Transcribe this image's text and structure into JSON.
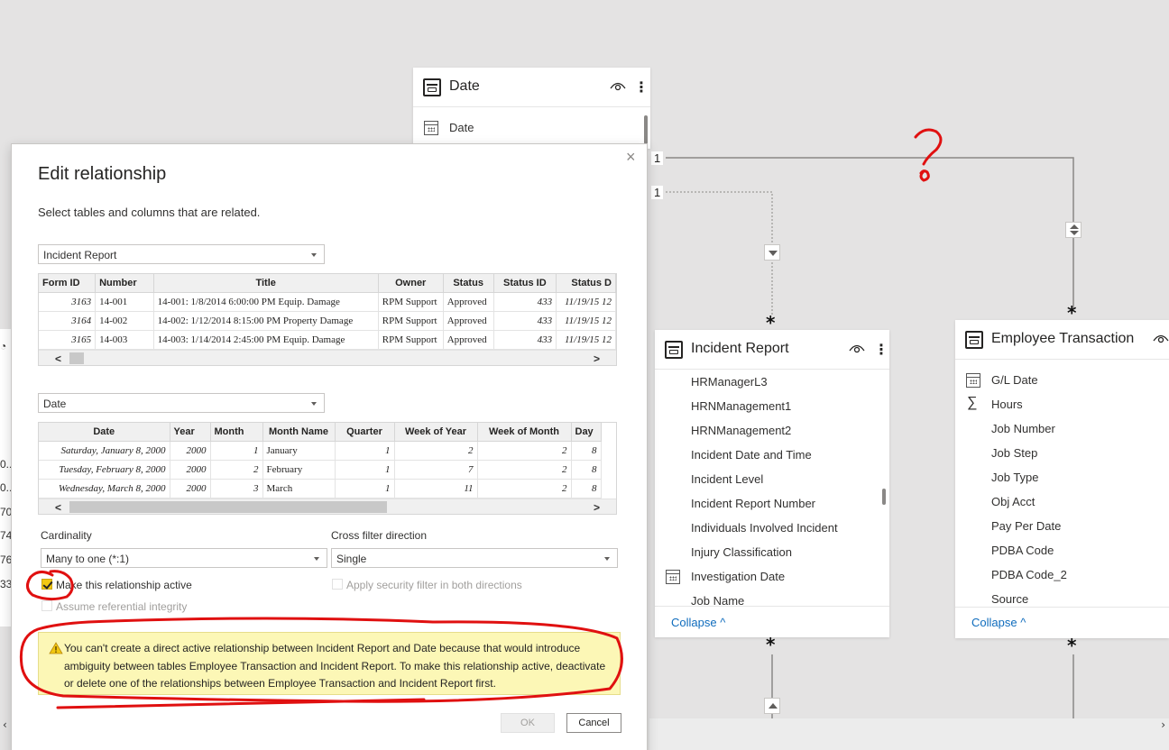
{
  "colors": {
    "canvas": "#e4e3e3",
    "accent_link": "#0f6cbd",
    "warning_bg": "#fcf7b6",
    "checkbox_checked": "#f2c811",
    "annotation_red": "#e01010"
  },
  "date_table": {
    "title": "Date",
    "fields": [
      {
        "name": "Date",
        "icon": "calendar-icon"
      }
    ]
  },
  "relationships": {
    "one_label_1": "1",
    "one_label_2": "1",
    "many_label": "*"
  },
  "incident_table": {
    "title": "Incident Report",
    "fields": [
      {
        "name": "HRManagerL3",
        "icon": ""
      },
      {
        "name": "HRNManagement1",
        "icon": ""
      },
      {
        "name": "HRNManagement2",
        "icon": ""
      },
      {
        "name": "Incident Date and Time",
        "icon": ""
      },
      {
        "name": "Incident Level",
        "icon": ""
      },
      {
        "name": "Incident Report Number",
        "icon": ""
      },
      {
        "name": "Individuals Involved Incident",
        "icon": ""
      },
      {
        "name": "Injury Classification",
        "icon": ""
      },
      {
        "name": "Investigation Date",
        "icon": "calendar-icon"
      },
      {
        "name": "Job Name",
        "icon": ""
      }
    ],
    "collapse": "Collapse"
  },
  "employee_table": {
    "title": "Employee Transaction",
    "fields": [
      {
        "name": "G/L Date",
        "icon": "calendar-icon"
      },
      {
        "name": "Hours",
        "icon": "sigma-icon"
      },
      {
        "name": "Job Number",
        "icon": ""
      },
      {
        "name": "Job Step",
        "icon": ""
      },
      {
        "name": "Job Type",
        "icon": ""
      },
      {
        "name": "Obj Acct",
        "icon": ""
      },
      {
        "name": "Pay Per Date",
        "icon": ""
      },
      {
        "name": "PDBA Code",
        "icon": ""
      },
      {
        "name": "PDBA Code_2",
        "icon": ""
      },
      {
        "name": "Source",
        "icon": ""
      }
    ],
    "collapse": "Collapse"
  },
  "left_partial": [
    "0...",
    "0...",
    "70",
    "74",
    "76",
    "33"
  ],
  "dialog": {
    "title": "Edit relationship",
    "subtitle": "Select tables and columns that are related.",
    "table1": {
      "selected": "Incident Report",
      "columns": [
        "Form ID",
        "Number",
        "Title",
        "Owner",
        "Status",
        "Status ID",
        "Status D"
      ],
      "rows": [
        [
          "3163",
          "14-001",
          "14-001: 1/8/2014 6:00:00 PM Equip. Damage",
          "RPM Support",
          "Approved",
          "433",
          "11/19/15 12"
        ],
        [
          "3164",
          "14-002",
          "14-002: 1/12/2014 8:15:00 PM Property Damage",
          "RPM Support",
          "Approved",
          "433",
          "11/19/15 12"
        ],
        [
          "3165",
          "14-003",
          "14-003: 1/14/2014 2:45:00 PM Equip. Damage",
          "RPM Support",
          "Approved",
          "433",
          "11/19/15 12"
        ]
      ]
    },
    "table2": {
      "selected": "Date",
      "columns": [
        "Date",
        "Year",
        "Month",
        "Month Name",
        "Quarter",
        "Week of Year",
        "Week of Month",
        "Day"
      ],
      "rows": [
        [
          "Saturday, January 8, 2000",
          "2000",
          "1",
          "January",
          "1",
          "2",
          "2",
          "8"
        ],
        [
          "Tuesday, February 8, 2000",
          "2000",
          "2",
          "February",
          "1",
          "7",
          "2",
          "8"
        ],
        [
          "Wednesday, March 8, 2000",
          "2000",
          "3",
          "March",
          "1",
          "11",
          "2",
          "8"
        ]
      ]
    },
    "cardinality_label": "Cardinality",
    "cardinality_value": "Many to one (*:1)",
    "crossfilter_label": "Cross filter direction",
    "crossfilter_value": "Single",
    "active_label": "Make this relationship active",
    "active_checked": true,
    "security_label": "Apply security filter in both directions",
    "referential_label": "Assume referential integrity",
    "warning": "You can't create a direct active relationship between Incident Report and Date because that would introduce ambiguity between tables Employee Transaction and Incident Report. To make this relationship active, deactivate or delete one of the relationships between Employee Transaction and Incident Report first.",
    "ok": "OK",
    "cancel": "Cancel",
    "close": "×"
  }
}
